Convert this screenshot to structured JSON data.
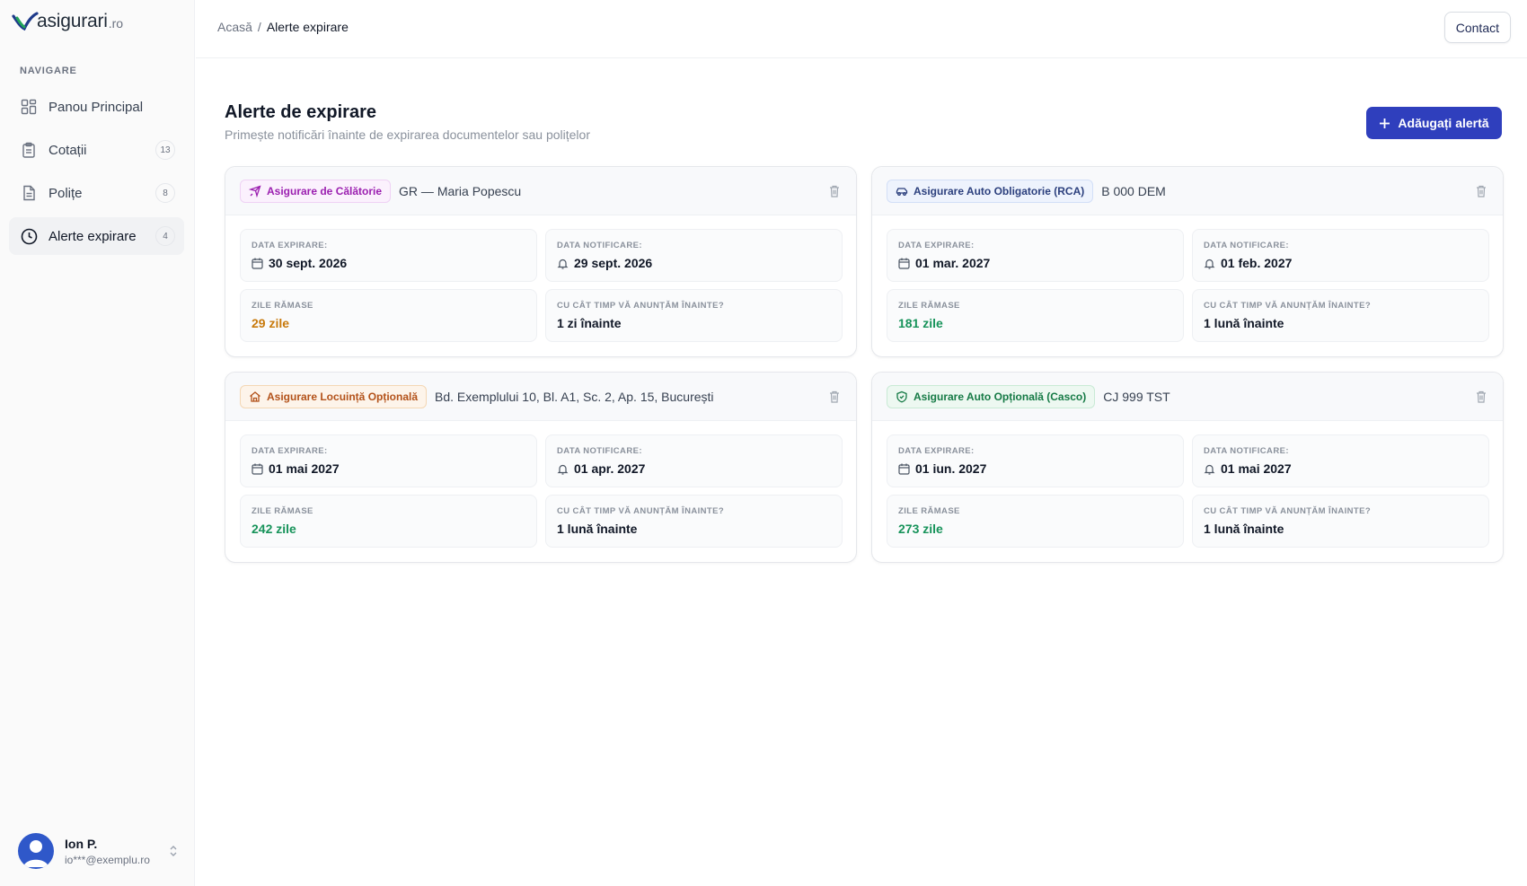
{
  "brand": {
    "name": "asigurari",
    "tld": ".ro"
  },
  "sidebar": {
    "heading": "NAVIGARE",
    "items": [
      {
        "label": "Panou Principal",
        "icon": "dashboard-icon",
        "badge": ""
      },
      {
        "label": "Cotații",
        "icon": "clipboard-icon",
        "badge": "13"
      },
      {
        "label": "Polițe",
        "icon": "document-icon",
        "badge": "8"
      },
      {
        "label": "Alerte expirare",
        "icon": "clock-icon",
        "badge": "4",
        "active": true
      }
    ]
  },
  "user": {
    "name": "Ion P.",
    "email": "io***@exemplu.ro"
  },
  "header": {
    "breadcrumb_home": "Acasă",
    "breadcrumb_sep": "/",
    "breadcrumb_current": "Alerte expirare",
    "contact_label": "Contact"
  },
  "main": {
    "title": "Alerte de expirare",
    "subtitle": "Primește notificări înainte de expirarea documentelor sau polițelor",
    "add_label": "Adăugați alertă",
    "labels": {
      "expiry": "DATA EXPIRARE:",
      "notify": "DATA NOTIFICARE:",
      "days": "ZILE RĂMASE",
      "advance": "CU CÂT TIMP VĂ ANUNȚĂM ÎNAINTE?"
    },
    "alerts": [
      {
        "type": "Asigurare de Călătorie",
        "tag_color": "purple",
        "icon": "plane-icon",
        "subject": "GR — Maria Popescu",
        "expiry": "30 sept. 2026",
        "notify": "29 sept. 2026",
        "days": "29 zile",
        "days_color": "orange",
        "advance": "1 zi înainte"
      },
      {
        "type": "Asigurare Auto Obligatorie (RCA)",
        "tag_color": "blue",
        "icon": "car-icon",
        "subject": "B 000 DEM",
        "expiry": "01 mar. 2027",
        "notify": "01 feb. 2027",
        "days": "181 zile",
        "days_color": "green",
        "advance": "1 lună înainte"
      },
      {
        "type": "Asigurare Locuință Opțională",
        "tag_color": "orange",
        "icon": "home-icon",
        "subject": "Bd. Exemplului 10, Bl. A1, Sc. 2, Ap. 15, București",
        "expiry": "01 mai 2027",
        "notify": "01 apr. 2027",
        "days": "242 zile",
        "days_color": "green",
        "advance": "1 lună înainte"
      },
      {
        "type": "Asigurare Auto Opțională (Casco)",
        "tag_color": "green",
        "icon": "shield-icon",
        "subject": "CJ 999 TST",
        "expiry": "01 iun. 2027",
        "notify": "01 mai 2027",
        "days": "273 zile",
        "days_color": "green",
        "advance": "1 lună înainte"
      }
    ]
  }
}
